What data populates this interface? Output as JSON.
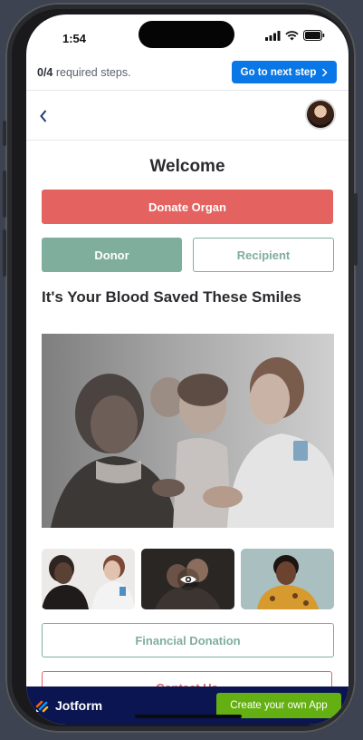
{
  "status_bar": {
    "time": "1:54"
  },
  "steps": {
    "count": "0/4",
    "text": " required steps.",
    "next_label": "Go to next step"
  },
  "nav": {
    "back_glyph": "‹"
  },
  "content": {
    "title": "Welcome",
    "donate_label": "Donate Organ",
    "donor_label": "Donor",
    "recipient_label": "Recipient",
    "headline": "It's Your Blood Saved These Smiles",
    "financial_label": "Financial Donation",
    "contact_label": "Contact Us"
  },
  "footer": {
    "brand": "Jotform",
    "create_label": "Create your own App"
  },
  "colors": {
    "primary_blue": "#0a77e6",
    "donate_red": "#e46361",
    "donor_green": "#7fae9d",
    "footer_navy": "#0a1551",
    "cta_green": "#64b012"
  },
  "icons": [
    "signal-icon",
    "wifi-icon",
    "battery-icon",
    "chevron-right-icon",
    "back-chevron-icon",
    "eye-icon",
    "jotform-logo-icon"
  ]
}
